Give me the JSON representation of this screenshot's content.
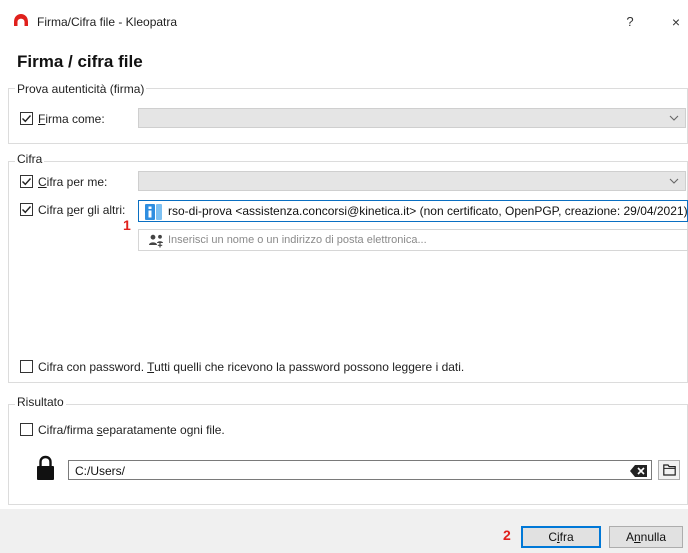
{
  "window": {
    "title": "Firma/Cifra file - Kleopatra",
    "help_label": "?",
    "close_label": "×",
    "accent_color": "#0078d7",
    "app_icon_color": "#e0201c"
  },
  "page": {
    "title": "Firma / cifra file"
  },
  "sign_group": {
    "label": "Prova autenticità (firma)",
    "sign_as": {
      "checked": true,
      "label_underline": "F",
      "label_rest": "irma come:",
      "value": ""
    }
  },
  "encrypt_group": {
    "label": "Cifra",
    "encrypt_for_me": {
      "checked": true,
      "label_underline": "C",
      "label_rest": "ifra per me:",
      "value": ""
    },
    "encrypt_for_others": {
      "checked": true,
      "label_pre": "Cifra ",
      "label_underline": "p",
      "label_rest": "er gli altri:",
      "recipient_text": "rso-di-prova <assistenza.concorsi@kinetica.it> (non certificato, OpenPGP, creazione: 29/04/2021)",
      "recipient_icon": "info-key-icon",
      "add_placeholder": "Inserisci un nome o un indirizzo di posta elettronica..."
    },
    "password": {
      "checked": false,
      "label_pre": "Cifra con password. ",
      "label_underline": "T",
      "label_rest": "utti quelli che ricevono la password possono leggere i dati."
    }
  },
  "output_group": {
    "label": "Risultato",
    "separately": {
      "checked": false,
      "label_pre": "Cifra/firma ",
      "label_underline": "s",
      "label_rest": "eparatamente ogni file."
    },
    "path": "C:/Users/",
    "lock_icon": "lock-icon",
    "clear_icon": "clear-text-icon",
    "browse_icon": "folder-icon"
  },
  "annotations": {
    "marker_1": "1",
    "marker_2": "2"
  },
  "footer": {
    "ok_pre": "C",
    "ok_underline": "i",
    "ok_rest": "fra",
    "cancel_pre": "A",
    "cancel_underline": "n",
    "cancel_rest": "nulla"
  }
}
